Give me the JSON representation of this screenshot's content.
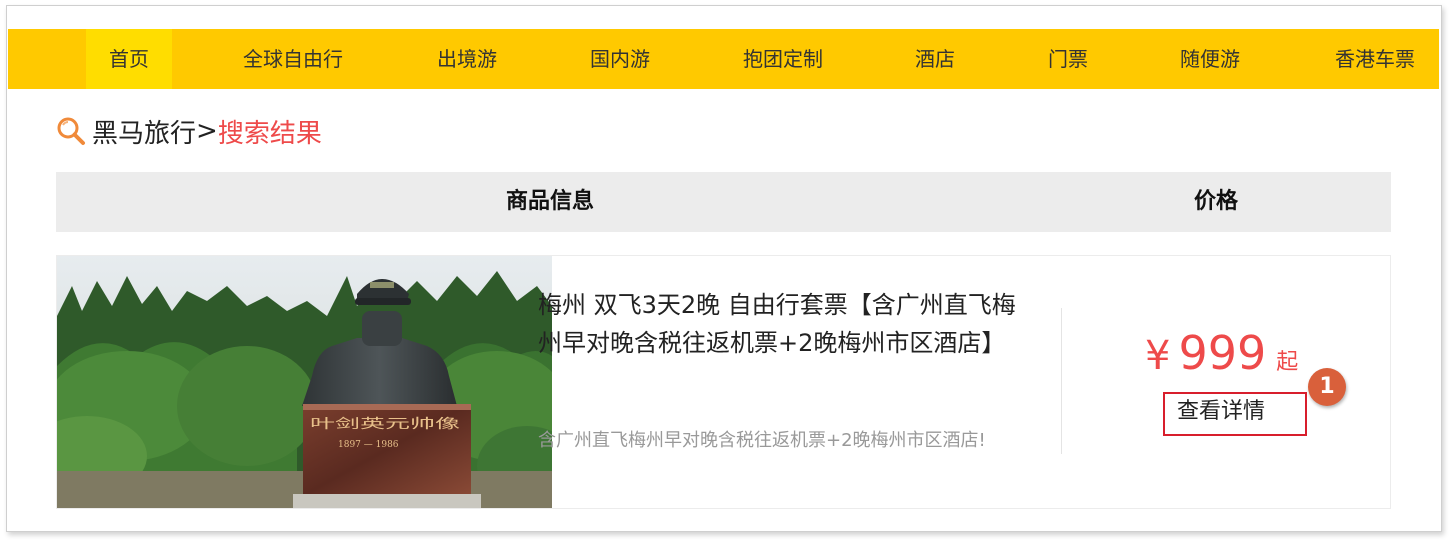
{
  "nav": {
    "items": [
      {
        "label": "首页",
        "active": true
      },
      {
        "label": "全球自由行"
      },
      {
        "label": "出境游"
      },
      {
        "label": "国内游"
      },
      {
        "label": "抱团定制"
      },
      {
        "label": "酒店"
      },
      {
        "label": "门票"
      },
      {
        "label": "随便游"
      },
      {
        "label": "香港车票"
      }
    ]
  },
  "breadcrumb": {
    "icon": "search-icon",
    "home": "黑马旅行",
    "separator": ">",
    "current": "搜索结果"
  },
  "table": {
    "headers": {
      "info": "商品信息",
      "price": "价格"
    }
  },
  "product": {
    "image_alt": "叶剑英元帅像",
    "statue_inscription": "叶剑英元帅像",
    "statue_years": "1897 — 1986",
    "title": "梅州 双飞3天2晚 自由行套票【含广州直飞梅州早对晚含税往返机票+2晚梅州市区酒店】",
    "description": "含广州直飞梅州早对晚含税往返机票+2晚梅州市区酒店!",
    "price_symbol": "¥",
    "price": "999",
    "price_suffix": "起",
    "detail_button": "查看详情",
    "marker": "1"
  },
  "colors": {
    "nav_bg": "#ffc900",
    "nav_active": "#ffdd00",
    "accent_red": "#ee4a4a",
    "header_bg": "#ececec"
  }
}
